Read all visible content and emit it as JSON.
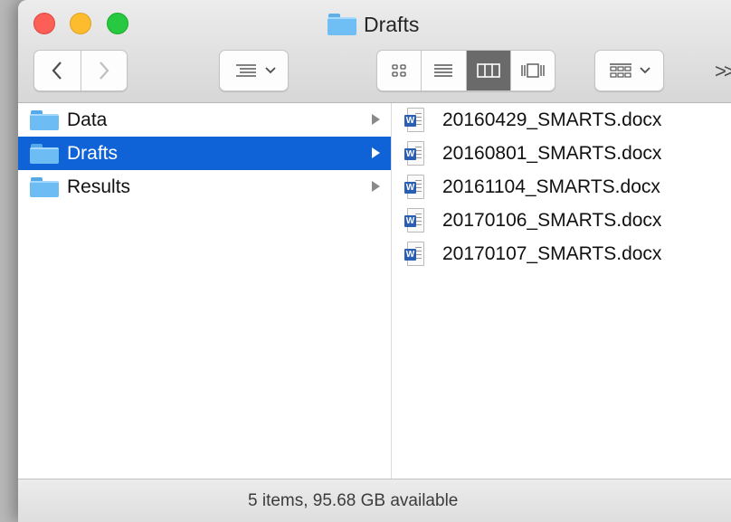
{
  "window": {
    "title": "Drafts"
  },
  "toolbar": {
    "back_icon": "chevron-left-icon",
    "forward_icon": "chevron-right-icon",
    "arrange_icon": "list-arrange-icon",
    "views": [
      "icon-view",
      "list-view",
      "column-view",
      "cover-flow-view"
    ],
    "active_view": "column-view",
    "group_icon": "group-by-icon",
    "more_label": ">>"
  },
  "sidebar_column": {
    "items": [
      {
        "label": "Data",
        "selected": false
      },
      {
        "label": "Drafts",
        "selected": true
      },
      {
        "label": "Results",
        "selected": false
      }
    ]
  },
  "files_column": {
    "items": [
      {
        "label": "20160429_SMARTS.docx"
      },
      {
        "label": "20160801_SMARTS.docx"
      },
      {
        "label": "20161104_SMARTS.docx"
      },
      {
        "label": "20170106_SMARTS.docx"
      },
      {
        "label": "20170107_SMARTS.docx"
      }
    ]
  },
  "status": {
    "text": "5 items, 95.68 GB available"
  },
  "colors": {
    "selection": "#0f63d6",
    "folder": "#6dbdf4",
    "word": "#2a5eb3"
  }
}
